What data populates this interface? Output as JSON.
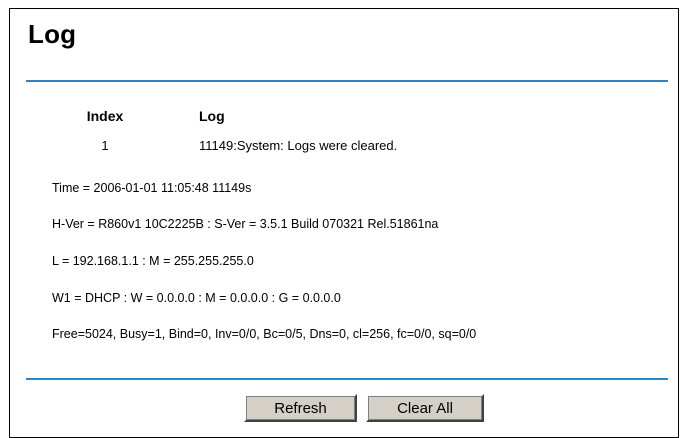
{
  "page": {
    "title": "Log"
  },
  "log_table": {
    "headers": {
      "index": "Index",
      "log": "Log"
    },
    "rows": [
      {
        "index": "1",
        "log": "11149:System: Logs were cleared."
      }
    ]
  },
  "system_info": {
    "time": "Time = 2006-01-01 11:05:48 11149s",
    "version": "H-Ver = R860v1 10C2225B : S-Ver = 3.5.1 Build 070321 Rel.51861na",
    "lan": "L = 192.168.1.1 : M = 255.255.255.0",
    "wan": "W1 = DHCP : W = 0.0.0.0 : M = 0.0.0.0 : G = 0.0.0.0",
    "stats": "Free=5024, Busy=1, Bind=0, Inv=0/0, Bc=0/5, Dns=0, cl=256, fc=0/0, sq=0/0"
  },
  "actions": {
    "refresh_label": "Refresh",
    "clear_all_label": "Clear All"
  },
  "colors": {
    "rule": "#2f86c6",
    "button_face": "#d4d0c8"
  }
}
